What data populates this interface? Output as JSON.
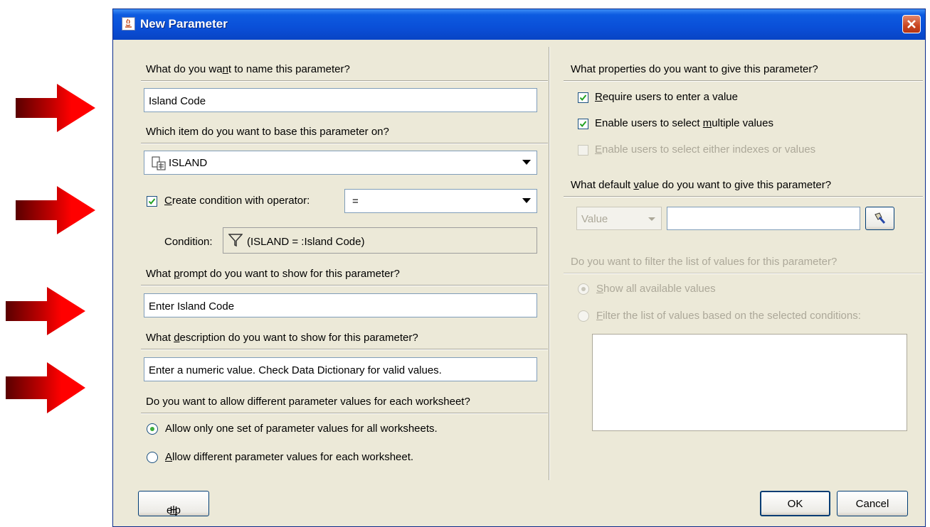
{
  "dialog": {
    "title": "New Parameter",
    "close_icon": "close-icon"
  },
  "left": {
    "name_question": [
      "What do you wa",
      "n",
      "t to name this parameter?"
    ],
    "name_value": "Island Code",
    "item_question": "Which item do you want to base this parameter on?",
    "item_value": "ISLAND",
    "create_condition": {
      "label_u": "C",
      "label_rest": "reate condition with operator:",
      "checked": true
    },
    "operator_value": "=",
    "condition_label": "Condition:",
    "condition_value": "(ISLAND = :Island Code)",
    "prompt_question": [
      "What ",
      "p",
      "rompt do you want to show for this parameter?"
    ],
    "prompt_value": "Enter Island Code",
    "description_question": [
      "What ",
      "d",
      "escription do you want to show for this parameter?"
    ],
    "description_value": "Enter a numeric value.  Check Data Dictionary for valid values.",
    "allow_question": "Do you want to allow different parameter values for each worksheet?",
    "radio_one": {
      "label": "Allow only one set of parameter values for all worksheets.",
      "selected": true
    },
    "radio_diff": {
      "label_u": "A",
      "label_rest": "llow different parameter values for each worksheet.",
      "selected": false
    }
  },
  "right": {
    "properties_question": "What properties do you want to give this parameter?",
    "require": {
      "label_u": "R",
      "label_rest": "equire users to enter a value",
      "checked": true
    },
    "multiple": {
      "label_pre": "Enable users to select ",
      "label_u": "m",
      "label_rest": "ultiple values",
      "checked": true
    },
    "indexes": {
      "label_u": "E",
      "label_rest": "nable users to select either indexes or values",
      "checked": false,
      "disabled": true
    },
    "default_question": [
      "What default ",
      "v",
      "alue do you want to give this parameter?"
    ],
    "default_type": "Value",
    "default_value": "",
    "filter_question": "Do you want to filter the list of values for this parameter?",
    "show_all": {
      "label_u": "S",
      "label_rest": "how all available values",
      "selected": true
    },
    "filter_list": {
      "label_u": "F",
      "label_rest": "ilter the list of values based on the selected conditions:",
      "selected": false
    }
  },
  "buttons": {
    "help": {
      "u": "H",
      "rest": "elp"
    },
    "ok": "OK",
    "cancel": "Cancel"
  },
  "colors": {
    "arrow": "#ff0000",
    "arrow_dark": "#6b0000",
    "titlebar": "#0a4fd8",
    "dialog_bg": "#ece9d8"
  }
}
